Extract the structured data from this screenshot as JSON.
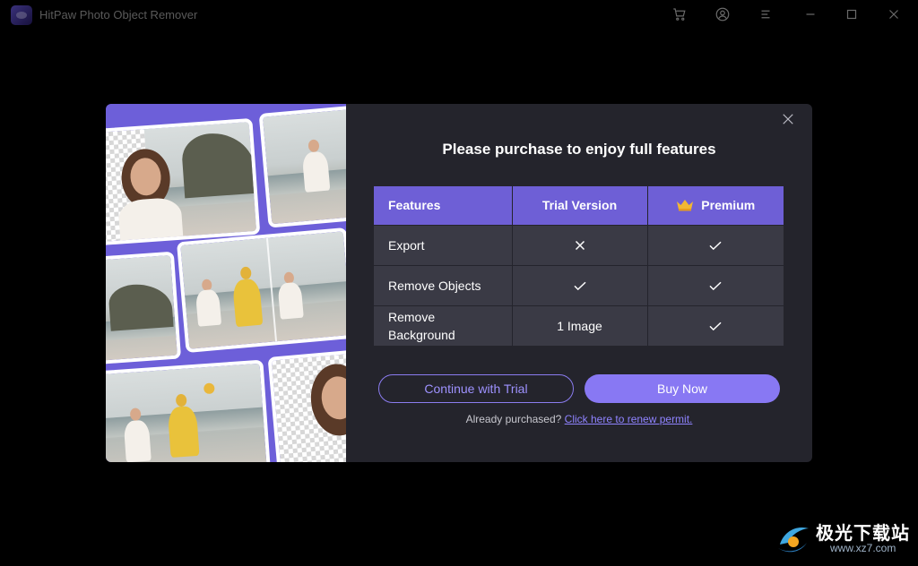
{
  "window": {
    "title": "HitPaw Photo Object Remover",
    "controls": [
      "cart-icon",
      "account-icon",
      "menu-icon",
      "minimize-icon",
      "maximize-icon",
      "close-icon"
    ]
  },
  "dialog": {
    "title": "Please purchase to enjoy full features",
    "table": {
      "headers": {
        "features": "Features",
        "trial": "Trial Version",
        "premium": "Premium"
      },
      "rows": [
        {
          "feature": "Export",
          "trial": "cross",
          "premium": "check"
        },
        {
          "feature": "Remove Objects",
          "trial": "check",
          "premium": "check"
        },
        {
          "feature": "Remove Background",
          "trial_text": "1 Image",
          "premium": "check"
        }
      ]
    },
    "buttons": {
      "trial": "Continue with Trial",
      "buy": "Buy Now"
    },
    "renew": {
      "prefix": "Already purchased?",
      "link": "Click here to renew permit."
    }
  },
  "watermark": {
    "text": "极光下载站",
    "url": "www.xz7.com"
  },
  "colors": {
    "accent": "#6e5fd6",
    "button": "#8878f3",
    "link": "#8f83ff",
    "dialog_bg": "#24242c",
    "row_bg": "#3a3a45"
  }
}
